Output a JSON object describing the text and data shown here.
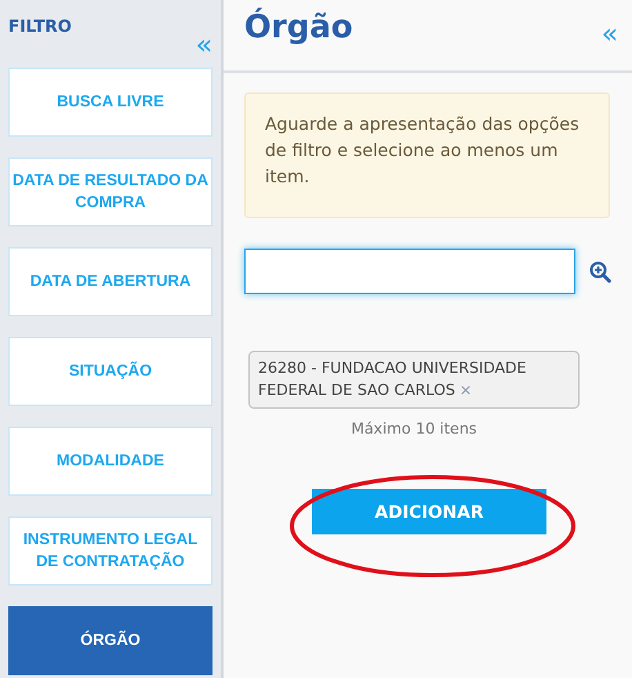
{
  "sidebar": {
    "title": "FILTRO",
    "collapse_icon": "«",
    "items": [
      {
        "label": "BUSCA LIVRE",
        "selected": false
      },
      {
        "label": "DATA DE RESULTADO DA COMPRA",
        "selected": false
      },
      {
        "label": "DATA DE ABERTURA",
        "selected": false
      },
      {
        "label": "SITUAÇÃO",
        "selected": false
      },
      {
        "label": "MODALIDADE",
        "selected": false
      },
      {
        "label": "INSTRUMENTO LEGAL DE CONTRATAÇÃO",
        "selected": false
      },
      {
        "label": "ÓRGÃO",
        "selected": true
      }
    ]
  },
  "panel": {
    "title": "Órgão",
    "collapse_icon": "«",
    "notice": "Aguarde a apresentação das opções de filtro e selecione ao menos um item.",
    "chips": [
      {
        "label": "26280 - FUNDACAO UNIVERSIDADE FEDERAL DE SAO CARLOS",
        "remove_icon": "×"
      }
    ],
    "limit_note": "Máximo 10 itens",
    "add_button": "ADICIONAR",
    "annotation": {
      "kind": "ellipse",
      "color": "#e0101a"
    }
  }
}
